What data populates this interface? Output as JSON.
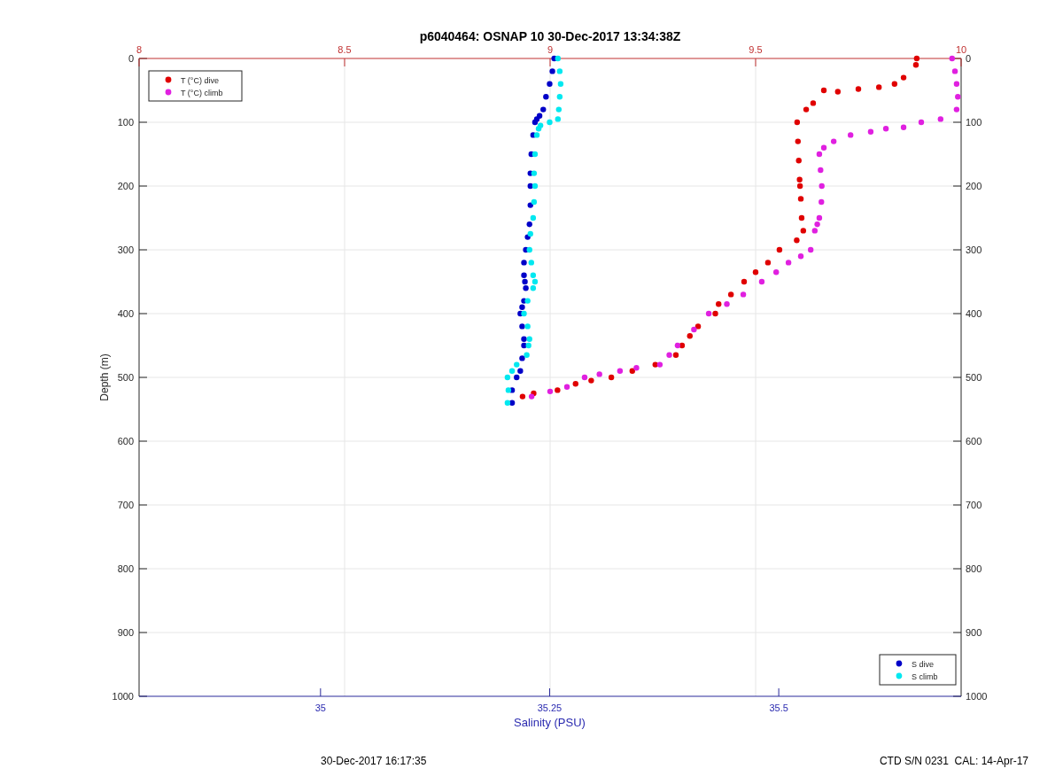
{
  "figure": {
    "chart_data": {
      "type": "scatter",
      "title": "p6040464: OSNAP 10 30-Dec-2017 13:34:38Z",
      "xlabel": "Salinity (PSU)",
      "ylabel": "Depth (m)",
      "grid": true,
      "legend": true,
      "xlim": [
        34.802,
        35.699
      ],
      "xticks": [
        35,
        35.25,
        35.5
      ],
      "x2lim": [
        8,
        10
      ],
      "x2ticks": [
        8,
        8.5,
        9,
        9.5,
        10
      ],
      "ylim": [
        1000,
        0
      ],
      "y2lim": [
        1000,
        0
      ],
      "yticks": [
        0,
        100,
        200,
        300,
        400,
        500,
        600,
        700,
        800,
        900,
        1000
      ],
      "y2ticks": [
        0,
        100,
        200,
        300,
        400,
        500,
        600,
        700,
        800,
        900,
        1000
      ],
      "series": [
        {
          "name": "T (°C) dive",
          "color": "#e00000",
          "axis": "x2",
          "x": [
            9.892,
            9.89,
            9.86,
            9.838,
            9.8,
            9.75,
            9.7,
            9.666,
            9.64,
            9.623,
            9.601,
            9.603,
            9.605,
            9.607,
            9.608,
            9.61,
            9.612,
            9.616,
            9.6,
            9.558,
            9.53,
            9.5,
            9.472,
            9.44,
            9.41,
            9.402,
            9.36,
            9.34,
            9.321,
            9.306,
            9.256,
            9.2,
            9.149,
            9.1,
            9.062,
            9.018,
            8.96,
            8.933
          ],
          "values": [
            0,
            10,
            30,
            40,
            45,
            48,
            52,
            50,
            70,
            80,
            100,
            130,
            160,
            190,
            200,
            220,
            250,
            270,
            285,
            300,
            320,
            335,
            350,
            370,
            385,
            400,
            420,
            435,
            450,
            465,
            480,
            490,
            500,
            505,
            510,
            520,
            525,
            530
          ]
        },
        {
          "name": "T (°C) climb",
          "color": "#e020e0",
          "axis": "x2",
          "x": [
            9.978,
            9.985,
            9.989,
            9.992,
            9.989,
            9.95,
            9.903,
            9.86,
            9.817,
            9.78,
            9.731,
            9.69,
            9.666,
            9.655,
            9.658,
            9.661,
            9.66,
            9.655,
            9.65,
            9.644,
            9.634,
            9.61,
            9.58,
            9.55,
            9.515,
            9.47,
            9.43,
            9.386,
            9.35,
            9.31,
            9.29,
            9.267,
            9.21,
            9.17,
            9.12,
            9.084,
            9.041,
            9.0,
            8.955
          ],
          "values": [
            0,
            20,
            40,
            60,
            80,
            95,
            100,
            108,
            110,
            115,
            120,
            130,
            140,
            150,
            175,
            200,
            225,
            250,
            260,
            270,
            300,
            310,
            320,
            335,
            350,
            370,
            385,
            400,
            425,
            450,
            465,
            480,
            485,
            490,
            495,
            500,
            515,
            522,
            530
          ]
        },
        {
          "name": "S dive",
          "color": "#0000c8",
          "x": [
            35.255,
            35.253,
            35.25,
            35.246,
            35.243,
            35.239,
            35.236,
            35.234,
            35.232,
            35.23,
            35.229,
            35.229,
            35.229,
            35.228,
            35.226,
            35.224,
            35.222,
            35.222,
            35.223,
            35.224,
            35.222,
            35.22,
            35.218,
            35.22,
            35.222,
            35.222,
            35.22,
            35.218,
            35.214,
            35.209,
            35.209
          ],
          "values": [
            0,
            20,
            40,
            60,
            80,
            90,
            95,
            100,
            120,
            150,
            180,
            200,
            230,
            260,
            280,
            300,
            320,
            340,
            350,
            360,
            380,
            390,
            400,
            420,
            440,
            450,
            470,
            490,
            500,
            520,
            540
          ]
        },
        {
          "name": "S climb",
          "color": "#00e8f0",
          "x": [
            35.259,
            35.261,
            35.262,
            35.261,
            35.26,
            35.259,
            35.25,
            35.24,
            35.238,
            35.236,
            35.234,
            35.233,
            35.234,
            35.233,
            35.232,
            35.229,
            35.228,
            35.23,
            35.232,
            35.234,
            35.232,
            35.226,
            35.222,
            35.226,
            35.228,
            35.227,
            35.225,
            35.214,
            35.209,
            35.204,
            35.205,
            35.204
          ],
          "values": [
            0,
            20,
            40,
            60,
            80,
            95,
            100,
            105,
            110,
            120,
            150,
            180,
            200,
            225,
            250,
            275,
            300,
            320,
            340,
            350,
            360,
            380,
            400,
            420,
            440,
            450,
            465,
            480,
            490,
            500,
            520,
            540
          ]
        }
      ]
    },
    "footer": {
      "left": "30-Dec-2017 16:17:35",
      "right": "CTD S/N 0231  CAL: 14-Apr-17"
    }
  }
}
